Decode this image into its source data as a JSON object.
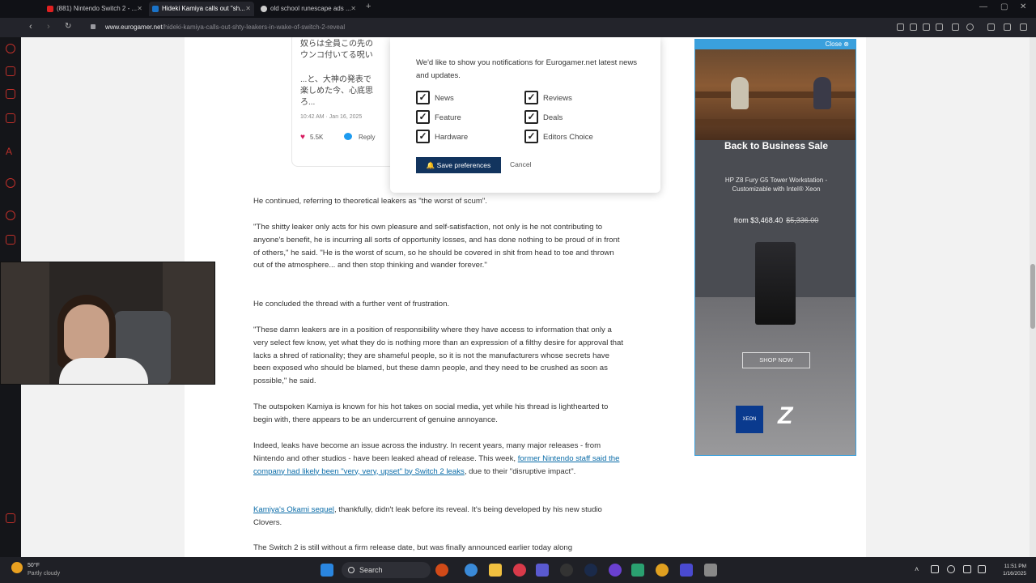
{
  "browser": {
    "tabs": [
      {
        "label": "(881) Nintendo Switch 2 - ...",
        "favicon_color": "#e02020"
      },
      {
        "label": "Hideki Kamiya calls out \"sh...",
        "favicon_color": "#1a73c8"
      },
      {
        "label": "old school runescape ads ...",
        "favicon_color": "#cccccc"
      }
    ],
    "url_domain": "www.eurogamer.net",
    "url_path": "/hideki-kamiya-calls-out-shty-leakers-in-wake-of-switch-2-reveal"
  },
  "tweet": {
    "lines": [
      "奴らは全員この先の",
      "ウンコ付いてる呪い",
      "",
      "...と、大神の発表で",
      "楽しめた今、心底思",
      "ろ..."
    ],
    "time": "10:42 AM · Jan 16, 2025",
    "likes": "5.5K",
    "reply_label": "Reply"
  },
  "notification": {
    "message": "We'd like to show you notifications for Eurogamer.net latest news and updates.",
    "options": [
      "News",
      "Reviews",
      "Feature",
      "Deals",
      "Hardware",
      "Editors Choice"
    ],
    "save_label": "Save preferences",
    "cancel_label": "Cancel"
  },
  "article": {
    "p1": "He continued, referring to theoretical leakers as \"the worst of scum\".",
    "p2": "\"The shitty leaker only acts for his own pleasure and self-satisfaction, not only is he not contributing to anyone's benefit, he is incurring all sorts of opportunity losses, and has done nothing to be proud of in front of others,\" he said. \"He is the worst of scum, so he should be covered in shit from head to toe and thrown out of the atmosphere... and then stop thinking and wander forever.\"",
    "p3": "He concluded the thread with a further vent of frustration.",
    "p4": "\"These damn leakers are in a position of responsibility where they have access to information that only a very select few know, yet what they do is nothing more than an expression of a filthy desire for approval that lacks a shred of rationality; they are shameful people, so it is not the manufacturers whose secrets have been exposed who should be blamed, but these damn people, and they need to be crushed as soon as possible,\" he said.",
    "p5": "The outspoken Kamiya is known for his hot takes on social media, yet while his thread is lighthearted to begin with, there appears to be an undercurrent of genuine annoyance.",
    "p6_pre": "Indeed, leaks have become an issue across the industry. In recent years, many major releases - from Nintendo and other studios - have been leaked ahead of release. This week, ",
    "p6_link": "former Nintendo staff said the company had likely been \"very, very, upset\" by Switch 2 leaks",
    "p6_post": ", due to their \"disruptive impact\".",
    "p7_link": "Kamiya's Okami sequel",
    "p7_post": ", thankfully, didn't leak before its reveal. It's being developed by his new studio Clovers.",
    "p8": "The Switch 2 is still without a firm release date, but was finally announced earlier today along"
  },
  "ad": {
    "close_label": "Close",
    "headline": "Back to Business Sale",
    "desc": "HP Z8 Fury G5 Tower Workstation - Customizable with Intel® Xeon",
    "price": "from $3,468.40",
    "old_price": "$5,336.00",
    "cta": "SHOP NOW",
    "chip": "XEON",
    "logo": "Z"
  },
  "taskbar": {
    "temp": "50°F",
    "weather": "Partly cloudy",
    "search": "Search",
    "time": "11:51 PM",
    "date": "1/16/2025"
  }
}
